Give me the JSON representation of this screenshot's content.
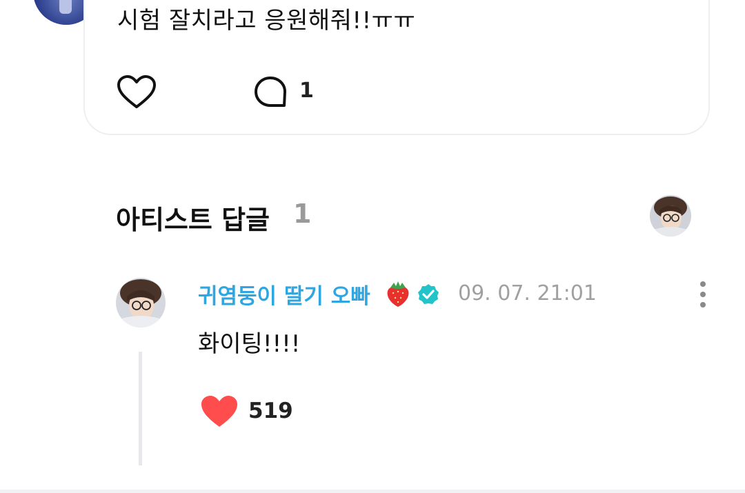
{
  "post": {
    "text": "시험 잘치라고 응원해줘!!ㅠㅠ",
    "comment_count": "1"
  },
  "artist_replies": {
    "title": "아티스트 답글",
    "count": "1"
  },
  "reply": {
    "author": "귀염둥이 딸기 오빠",
    "timestamp": "09. 07. 21:01",
    "text": "화이팅!!!!",
    "like_count": "519"
  },
  "colors": {
    "author_name": "#2fa6e0",
    "verified_badge": "#22c3c9",
    "heart_filled": "#ff4d4d",
    "muted_text": "#a0a0a0"
  },
  "icons": [
    "heart-outline-icon",
    "comment-bubble-icon",
    "strawberry-icon",
    "verified-badge-icon",
    "more-vertical-icon",
    "heart-filled-icon"
  ]
}
